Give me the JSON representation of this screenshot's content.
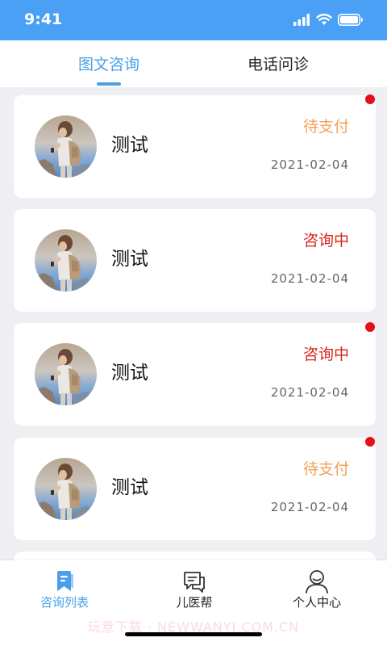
{
  "status_bar": {
    "time": "9:41",
    "icons": [
      "signal-icon",
      "wifi-icon",
      "battery-icon"
    ]
  },
  "tabs": [
    {
      "label": "图文咨询",
      "active": true
    },
    {
      "label": "电话问诊",
      "active": false
    }
  ],
  "consultations": [
    {
      "name": "测试",
      "status": "待支付",
      "status_color": "#f0a257",
      "date": "2021-02-04",
      "unread": true
    },
    {
      "name": "测试",
      "status": "咨询中",
      "status_color": "#d8261e",
      "date": "2021-02-04",
      "unread": false
    },
    {
      "name": "测试",
      "status": "咨询中",
      "status_color": "#d8261e",
      "date": "2021-02-04",
      "unread": true
    },
    {
      "name": "测试",
      "status": "待支付",
      "status_color": "#f0a257",
      "date": "2021-02-04",
      "unread": true
    }
  ],
  "bottom_nav": [
    {
      "label": "咨询列表",
      "icon": "consult-list-icon",
      "active": true
    },
    {
      "label": "儿医帮",
      "icon": "chat-icon",
      "active": false
    },
    {
      "label": "个人中心",
      "icon": "person-icon",
      "active": false
    }
  ],
  "colors": {
    "status_bar": "#4aa0f5",
    "accent": "#4a9fe8",
    "pending_status": "#f0a257",
    "in_progress_status": "#d8261e",
    "unread_dot": "#e60f1a",
    "background": "#eeeef3"
  },
  "watermark": "玩意下载 · NEWWANYI.COM.CN"
}
